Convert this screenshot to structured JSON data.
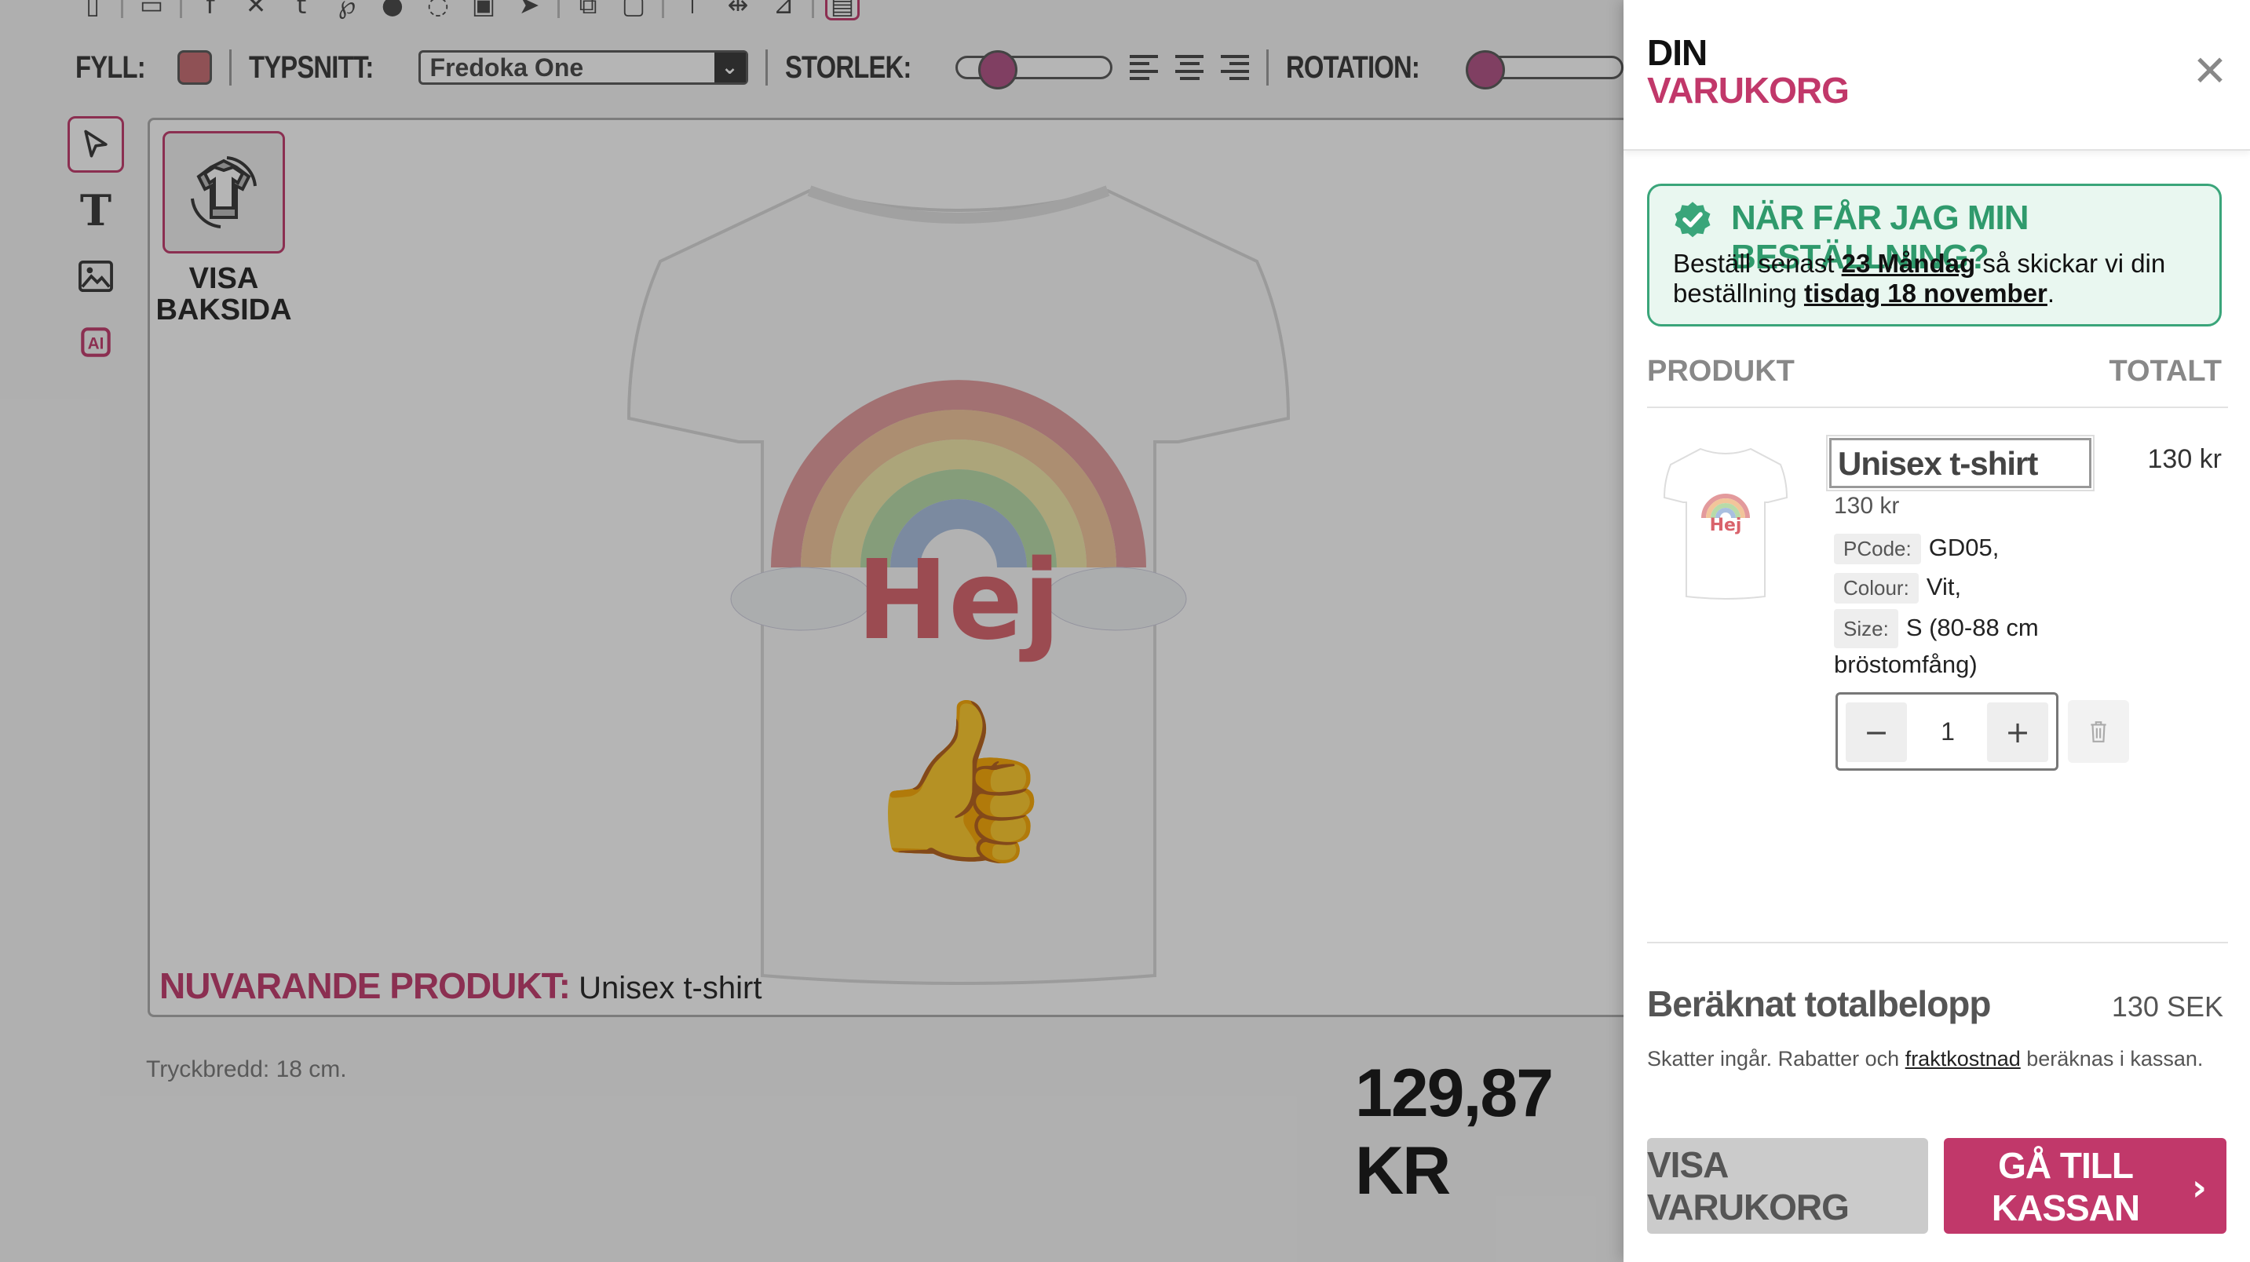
{
  "editor": {
    "toolbar": {
      "fill_label": "FYLL:",
      "font_label": "TYPSNITT:",
      "font_value": "Fredoka One",
      "size_label": "STORLEK:",
      "rotation_label": "ROTATION:",
      "fill_color": "#c76b70",
      "size_level": 0.2,
      "rotation_level": 0.0
    },
    "back_button_label_1": "VISA",
    "back_button_label_2": "BAKSIDA",
    "design_text": "Hej",
    "current_product_label": "NUVARANDE PRODUKT:",
    "current_product_value": "Unisex t-shirt",
    "print_width": "Tryckbredd: 18 cm.",
    "price": "129,87 KR"
  },
  "cart": {
    "title_line1": "DIN",
    "title_line2": "VARUKORG",
    "close_icon": "close-icon",
    "delivery": {
      "question": "NÄR FÅR JAG MIN BESTÄLLNING?",
      "text_prefix": "Beställ senast ",
      "order_by": "23 Måndag",
      "text_middle": " så skickar vi din beställning ",
      "ship_date": "tisdag 18 november",
      "text_suffix": "."
    },
    "columns": {
      "product": "PRODUKT",
      "total": "TOTALT"
    },
    "item": {
      "name": "Unisex t-shirt",
      "price": "130 kr",
      "total": "130 kr",
      "attributes": [
        {
          "key": "PCode:",
          "value": "GD05,"
        },
        {
          "key": "Colour:",
          "value": "Vit,"
        },
        {
          "key": "Size:",
          "value": "S (80-88 cm bröstomfång)"
        }
      ],
      "quantity": "1",
      "decrement": "−",
      "increment": "+"
    },
    "summary": {
      "total_label": "Beräknat totalbelopp",
      "total_value": "130 SEK",
      "tax_prefix": "Skatter ingår. Rabatter och ",
      "tax_link": "fraktkostnad",
      "tax_suffix": " beräknas i kassan."
    },
    "view_cart_button": "VISA VARUKORG",
    "checkout_button_line1": "GÅ TILL",
    "checkout_button_line2": "KASSAN",
    "accent_color": "#c1386a",
    "success_color": "#3aa57a"
  }
}
